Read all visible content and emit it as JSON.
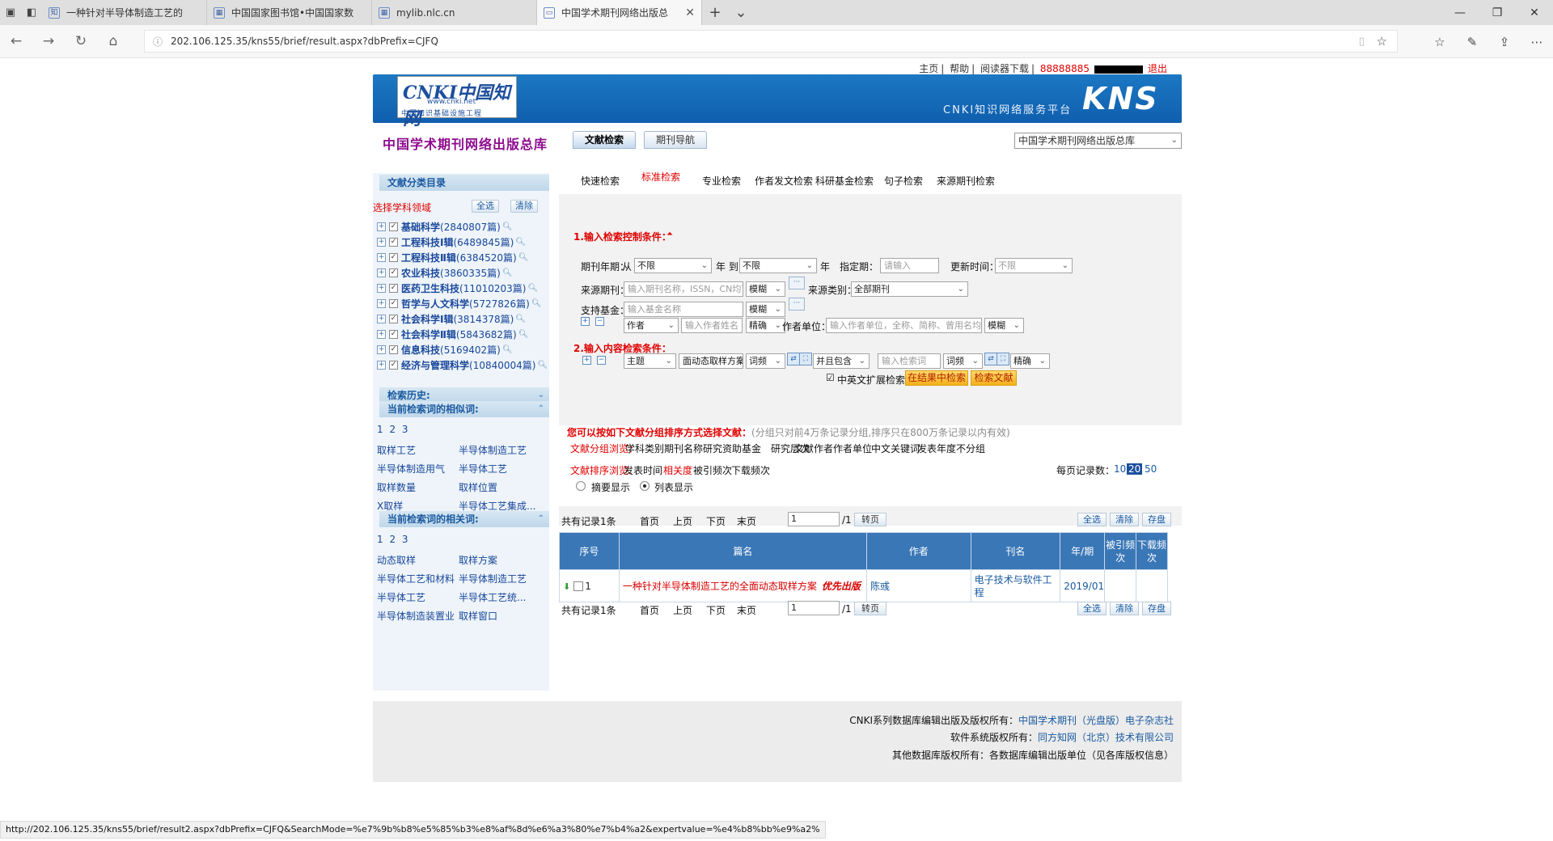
{
  "browser": {
    "tabs": [
      {
        "label": "一种针对半导体制造工艺的",
        "icon": "page-icon"
      },
      {
        "label": "中国国家图书馆•中国国家数",
        "icon": "nlc-icon"
      },
      {
        "label": "mylib.nlc.cn",
        "icon": "nlc-icon"
      },
      {
        "label": "中国学术期刊网络出版总",
        "icon": "page-icon",
        "active": true
      }
    ],
    "url": "202.106.125.35/kns55/brief/result.aspx?dbPrefix=CJFQ",
    "status_url": "http://202.106.125.35/kns55/brief/result2.aspx?dbPrefix=CJFQ&SearchMode=%e7%9b%b8%e5%85%b3%e8%af%8d%e6%a3%80%e7%b4%a2&expertvalue=%e4%b8%bb%e9%a2%"
  },
  "topnav": {
    "home": "主页",
    "help": "帮助",
    "reader": "阅读器下载",
    "user": "88888885",
    "logout": "退出"
  },
  "banner": {
    "logo_text": "CNKI中国知网",
    "logo_url": "www.cnki.net",
    "logo_sub": "中国知识基础设施工程",
    "platform": "CNKI知识网络服务平台",
    "kns": "KNS"
  },
  "db": {
    "title": "中国学术期刊网络出版总库",
    "tab_search": "文献检索",
    "tab_nav": "期刊导航",
    "select_value": "中国学术期刊网络出版总库"
  },
  "sidebar": {
    "catalog_title": "文献分类目录",
    "select_field": "选择学科领域",
    "select_all": "全选",
    "clear": "清除",
    "subjects": [
      {
        "name": "基础科学",
        "count": "(2840807篇)"
      },
      {
        "name": "工程科技Ⅰ辑",
        "count": "(6489845篇)"
      },
      {
        "name": "工程科技Ⅱ辑",
        "count": "(6384520篇)"
      },
      {
        "name": "农业科技",
        "count": "(3860335篇)"
      },
      {
        "name": "医药卫生科技",
        "count": "(11010203篇)"
      },
      {
        "name": "哲学与人文科学",
        "count": "(5727826篇)"
      },
      {
        "name": "社会科学Ⅰ辑",
        "count": "(3814378篇)"
      },
      {
        "name": "社会科学Ⅱ辑",
        "count": "(5843682篇)"
      },
      {
        "name": "信息科技",
        "count": "(5169402篇)"
      },
      {
        "name": "经济与管理科学",
        "count": "(10840004篇)"
      }
    ],
    "history_title": "检索历史:",
    "group_title": "当前检索词的相似词:",
    "group_pages": "1 2 3",
    "similar_words": [
      "取样工艺",
      "半导体制造工艺",
      "半导体制造用气",
      "半导体工艺",
      "取样数量",
      "取样位置",
      "X取样",
      "半导体工艺集成..."
    ],
    "related_title": "当前检索词的相关词:",
    "related_pages": "1 2 3",
    "related_words": [
      "动态取样",
      "取样方案",
      "半导体工艺和材料",
      "半导体制造工艺",
      "半导体工艺",
      "半导体工艺统...",
      "半导体制造装置业",
      "取样窗口"
    ]
  },
  "search": {
    "tabs": [
      "快速检索",
      "标准检索",
      "专业检索",
      "作者发文检索",
      "科研基金检索",
      "句子检索",
      "来源期刊检索"
    ],
    "active_tab": "标准检索",
    "section1": "1.输入检索控制条件：",
    "year_label": "期刊年期：",
    "from": "从",
    "year_from": "不限",
    "year_unit1": "年 到",
    "year_to": "不限",
    "year_unit2": "年",
    "specified_label": "指定期：",
    "specified_placeholder": "请输入",
    "update_label": "更新时间：",
    "update_value": "不限",
    "source_label": "来源期刊：",
    "source_placeholder": "输入期刊名称，ISSN，CN均可",
    "fuzzy": "模糊",
    "source_type_label": "来源类别：",
    "source_type_value": "全部期刊",
    "fund_label": "支持基金：",
    "fund_placeholder": "输入基金名称",
    "author_select": "作者",
    "author_placeholder": "输入作者姓名",
    "exact": "精确",
    "author_unit_label": "作者单位：",
    "author_unit_placeholder": "输入作者单位，全称、简称、曾用名均可",
    "section2": "2.输入内容检索条件：",
    "field_select": "主题",
    "keyword1": "面动态取样方案",
    "freq": "词频",
    "combine": "并且包含",
    "keyword2_placeholder": "输入检索词",
    "freq2": "词频",
    "exact2": "精确",
    "ext_label": "中英文扩展检索",
    "btn_in_result": "在结果中检索",
    "btn_search": "检索文献"
  },
  "group": {
    "hint_red": "您可以按如下文献分组排序方式选择文献：",
    "hint_gray": "(分组只对前4万条记录分组,排序只在800万条记录以内有效)",
    "group_label": "文献分组浏览：",
    "group_items": [
      "学科类别",
      "期刊名称",
      "研究资助基金",
      "研究层次",
      "文献作者",
      "作者单位",
      "中文关键词",
      "发表年度",
      "不分组"
    ],
    "sort_label": "文献排序浏览：",
    "sort_items": [
      "发表时间",
      "相关度",
      "被引频次",
      "下载频次"
    ],
    "per_page_label": "每页记录数：",
    "per_page": [
      "10",
      "20",
      "50"
    ],
    "per_page_current": "20",
    "abstract_view": "摘要显示",
    "list_view": "列表显示"
  },
  "pager": {
    "total": "共有记录1条",
    "first": "首页",
    "prev": "上页",
    "next": "下页",
    "last": "末页",
    "page": "1",
    "of": "/1",
    "go": "转页",
    "select_all": "全选",
    "clear": "清除",
    "save": "存盘"
  },
  "table": {
    "headers": [
      "序号",
      "篇名",
      "作者",
      "刊名",
      "年/期",
      "被引频次",
      "下载频次"
    ],
    "rows": [
      {
        "index": "1",
        "title": "一种针对半导体制造工艺的全面动态取样方案",
        "priority": "优先出版",
        "author": "陈彧",
        "journal": "电子技术与软件工程",
        "year": "2019/01",
        "cited": "",
        "downloads": ""
      }
    ]
  },
  "footer": {
    "line1_text": "CNKI系列数据库编辑出版及版权所有：",
    "line1_link": "中国学术期刊（光盘版）电子杂志社",
    "line2_text": "软件系统版权所有：",
    "line2_link": "同方知网（北京）技术有限公司",
    "line3_text": "其他数据库版权所有：各数据库编辑出版单位（见各库版权信息）"
  }
}
